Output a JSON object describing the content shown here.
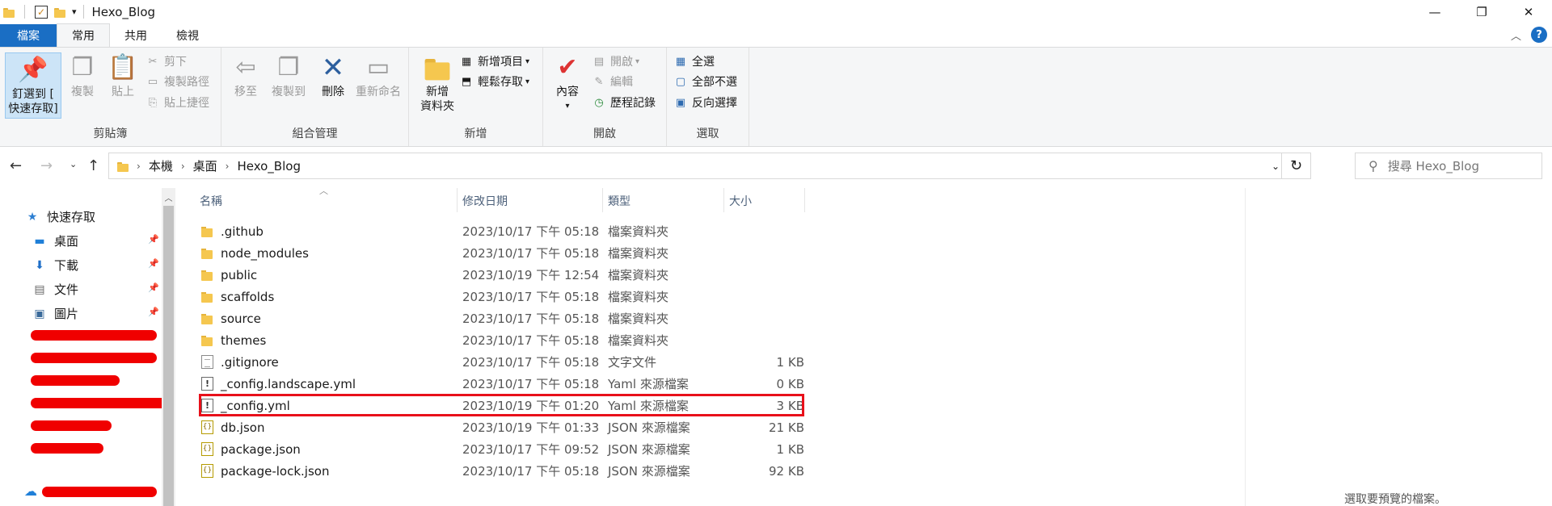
{
  "title_bar": {
    "title": "Hexo_Blog",
    "minimize": "—",
    "maximize": "❐",
    "close": "✕"
  },
  "ribbon_tabs": [
    "檔案",
    "常用",
    "共用",
    "檢視"
  ],
  "ribbon": {
    "clipboard": {
      "pin": "釘選到 [",
      "pin2": "快速存取]",
      "copy": "複製",
      "paste": "貼上",
      "cut": "剪下",
      "copy_path": "複製路徑",
      "paste_shortcut": "貼上捷徑",
      "label": "剪貼簿"
    },
    "organize": {
      "move_to": "移至",
      "copy_to": "複製到",
      "delete": "刪除",
      "rename": "重新命名",
      "label": "組合管理"
    },
    "new": {
      "new_folder": "新增",
      "new_folder2": "資料夾",
      "new_item": "新增項目",
      "easy_access": "輕鬆存取",
      "label": "新增"
    },
    "open": {
      "properties": "內容",
      "open": "開啟",
      "edit": "編輯",
      "history": "歷程記錄",
      "label": "開啟"
    },
    "select": {
      "select_all": "全選",
      "select_none": "全部不選",
      "invert": "反向選擇",
      "label": "選取"
    }
  },
  "address_bar": {
    "crumbs": [
      "本機",
      "桌面",
      "Hexo_Blog"
    ],
    "search_placeholder": "搜尋 Hexo_Blog"
  },
  "nav_pane": {
    "quick_access": "快速存取",
    "items": [
      "桌面",
      "下載",
      "文件",
      "圖片"
    ]
  },
  "columns": [
    "名稱",
    "修改日期",
    "類型",
    "大小"
  ],
  "files": [
    {
      "name": ".github",
      "date": "2023/10/17 下午 05:18",
      "type": "檔案資料夾",
      "size": "",
      "icon": "folder-icon"
    },
    {
      "name": "node_modules",
      "date": "2023/10/17 下午 05:18",
      "type": "檔案資料夾",
      "size": "",
      "icon": "folder-icon"
    },
    {
      "name": "public",
      "date": "2023/10/19 下午 12:54",
      "type": "檔案資料夾",
      "size": "",
      "icon": "folder-icon"
    },
    {
      "name": "scaffolds",
      "date": "2023/10/17 下午 05:18",
      "type": "檔案資料夾",
      "size": "",
      "icon": "folder-icon"
    },
    {
      "name": "source",
      "date": "2023/10/17 下午 05:18",
      "type": "檔案資料夾",
      "size": "",
      "icon": "folder-icon"
    },
    {
      "name": "themes",
      "date": "2023/10/17 下午 05:18",
      "type": "檔案資料夾",
      "size": "",
      "icon": "folder-icon"
    },
    {
      "name": ".gitignore",
      "date": "2023/10/17 下午 05:18",
      "type": "文字文件",
      "size": "1 KB",
      "icon": "text-file-icon"
    },
    {
      "name": "_config.landscape.yml",
      "date": "2023/10/17 下午 05:18",
      "type": "Yaml 來源檔案",
      "size": "0 KB",
      "icon": "yaml-file-icon"
    },
    {
      "name": "_config.yml",
      "date": "2023/10/19 下午 01:20",
      "type": "Yaml 來源檔案",
      "size": "3 KB",
      "icon": "yaml-file-icon"
    },
    {
      "name": "db.json",
      "date": "2023/10/19 下午 01:33",
      "type": "JSON 來源檔案",
      "size": "21 KB",
      "icon": "json-file-icon"
    },
    {
      "name": "package.json",
      "date": "2023/10/17 下午 09:52",
      "type": "JSON 來源檔案",
      "size": "1 KB",
      "icon": "json-file-icon"
    },
    {
      "name": "package-lock.json",
      "date": "2023/10/17 下午 05:18",
      "type": "JSON 來源檔案",
      "size": "92 KB",
      "icon": "json-file-icon"
    }
  ],
  "preview_text": "選取要預覽的檔案。",
  "colors": {
    "accent": "#1a6ec4",
    "highlight": "#e8101a",
    "redaction": "#f00000"
  }
}
